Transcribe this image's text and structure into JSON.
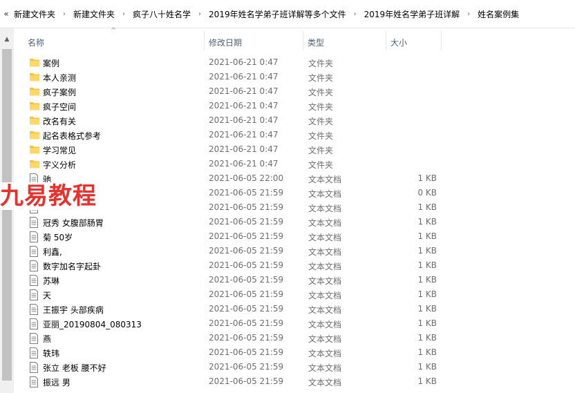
{
  "breadcrumb": {
    "back_glyph": "«",
    "items": [
      "新建文件夹",
      "新建文件夹",
      "疯子八十姓名学",
      "2019年姓名学弟子班详解等多个文件",
      "2019年姓名学弟子班详解",
      "姓名案例集"
    ],
    "sep_glyph": "›"
  },
  "columns": {
    "name": "名称",
    "date": "修改日期",
    "type": "类型",
    "size": "大小"
  },
  "watermark": "九易教程",
  "files": [
    {
      "name": "案例",
      "date": "2021-06-21 0:47",
      "type": "文件夹",
      "size": "",
      "icon": "folder-icon"
    },
    {
      "name": "本人亲测",
      "date": "2021-06-21 0:47",
      "type": "文件夹",
      "size": "",
      "icon": "folder-icon"
    },
    {
      "name": "疯子案例",
      "date": "2021-06-21 0:47",
      "type": "文件夹",
      "size": "",
      "icon": "folder-icon"
    },
    {
      "name": "疯子空间",
      "date": "2021-06-21 0:47",
      "type": "文件夹",
      "size": "",
      "icon": "folder-icon"
    },
    {
      "name": "改名有关",
      "date": "2021-06-21 0:47",
      "type": "文件夹",
      "size": "",
      "icon": "folder-icon"
    },
    {
      "name": "起名表格式参考",
      "date": "2021-06-21 0:47",
      "type": "文件夹",
      "size": "",
      "icon": "folder-icon"
    },
    {
      "name": "学习常见",
      "date": "2021-06-21 0:47",
      "type": "文件夹",
      "size": "",
      "icon": "folder-icon"
    },
    {
      "name": "字义分析",
      "date": "2021-06-21 0:47",
      "type": "文件夹",
      "size": "",
      "icon": "folder-icon"
    },
    {
      "name": "驰",
      "date": "2021-06-05 22:00",
      "type": "文本文档",
      "size": "1 KB",
      "icon": "text-file-icon"
    },
    {
      "name": "",
      "date": "2021-06-05 21:59",
      "type": "文本文档",
      "size": "0 KB",
      "icon": "text-file-icon"
    },
    {
      "name": "",
      "date": "2021-06-05 21:59",
      "type": "文本文档",
      "size": "1 KB",
      "icon": "text-file-icon"
    },
    {
      "name": "冠秀  女腹部肠胃",
      "date": "2021-06-05 21:59",
      "type": "文本文档",
      "size": "1 KB",
      "icon": "text-file-icon"
    },
    {
      "name": "菊 50岁",
      "date": "2021-06-05 21:59",
      "type": "文本文档",
      "size": "1 KB",
      "icon": "text-file-icon"
    },
    {
      "name": "利鑫,",
      "date": "2021-06-05 21:59",
      "type": "文本文档",
      "size": "1 KB",
      "icon": "text-file-icon"
    },
    {
      "name": "数字加名字起卦",
      "date": "2021-06-05 21:59",
      "type": "文本文档",
      "size": "1 KB",
      "icon": "text-file-icon"
    },
    {
      "name": "苏琳",
      "date": "2021-06-05 21:59",
      "type": "文本文档",
      "size": "1 KB",
      "icon": "text-file-icon"
    },
    {
      "name": "天",
      "date": "2021-06-05 21:59",
      "type": "文本文档",
      "size": "1 KB",
      "icon": "text-file-icon"
    },
    {
      "name": "王振宇 头部疾病",
      "date": "2021-06-05 21:59",
      "type": "文本文档",
      "size": "1 KB",
      "icon": "text-file-icon"
    },
    {
      "name": "亚丽_20190804_080313",
      "date": "2021-06-05 21:59",
      "type": "文本文档",
      "size": "1 KB",
      "icon": "text-file-icon"
    },
    {
      "name": "燕",
      "date": "2021-06-05 21:59",
      "type": "文本文档",
      "size": "1 KB",
      "icon": "text-file-icon"
    },
    {
      "name": "轶玮",
      "date": "2021-06-05 21:59",
      "type": "文本文档",
      "size": "1 KB",
      "icon": "text-file-icon"
    },
    {
      "name": "张立 老板 腰不好",
      "date": "2021-06-05 21:59",
      "type": "文本文档",
      "size": "1 KB",
      "icon": "text-file-icon"
    },
    {
      "name": "振远 男",
      "date": "2021-06-05 21:59",
      "type": "文本文档",
      "size": "1 KB",
      "icon": "text-file-icon"
    }
  ]
}
